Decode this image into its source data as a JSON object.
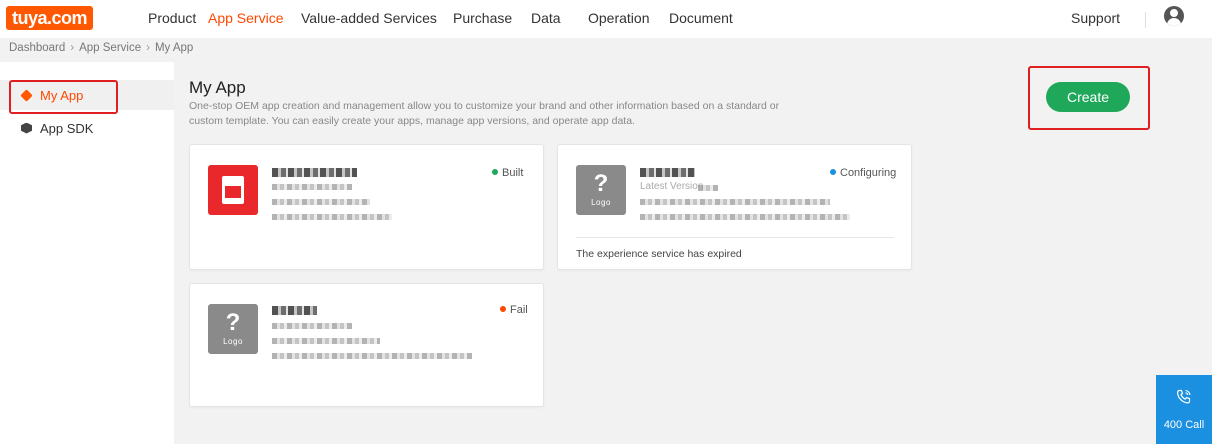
{
  "header": {
    "logo_text": "tuya.com",
    "nav": [
      {
        "label": "Product",
        "active": false
      },
      {
        "label": "App Service",
        "active": true
      },
      {
        "label": "Value-added Services",
        "active": false
      },
      {
        "label": "Purchase",
        "active": false
      },
      {
        "label": "Data",
        "active": false
      },
      {
        "label": "Operation",
        "active": false
      },
      {
        "label": "Document",
        "active": false
      }
    ],
    "support_label": "Support",
    "avatar_icon": "user-avatar-icon"
  },
  "breadcrumb": [
    "Dashboard",
    "App Service",
    "My App"
  ],
  "sidebar": {
    "items": [
      {
        "label": "My App",
        "icon": "layers-icon",
        "active": true
      },
      {
        "label": "App SDK",
        "icon": "cube-icon",
        "active": false
      }
    ]
  },
  "main": {
    "title": "My App",
    "description": "One-stop OEM app creation and management allow you to customize your brand and other information based on a standard or custom template. You can easily create your apps, manage app versions, and operate app data.",
    "create_label": "Create"
  },
  "apps": [
    {
      "status": "Built",
      "status_color": "#1fa85a",
      "logo": "app-logo-red"
    },
    {
      "status": "Configuring",
      "status_color": "#1b8fe0",
      "logo_label": "Logo",
      "latest_version_text": "Latest Version",
      "footer_text": "The experience service has expired"
    },
    {
      "status": "Fail",
      "status_color": "#ff4800",
      "logo_label": "Logo"
    }
  ],
  "call_widget": {
    "label": "400 Call",
    "icon": "phone-call-icon"
  },
  "colors": {
    "accent": "#ff4800",
    "create": "#1fa85a",
    "call": "#1b8fe0",
    "highlight": "#e02020"
  }
}
